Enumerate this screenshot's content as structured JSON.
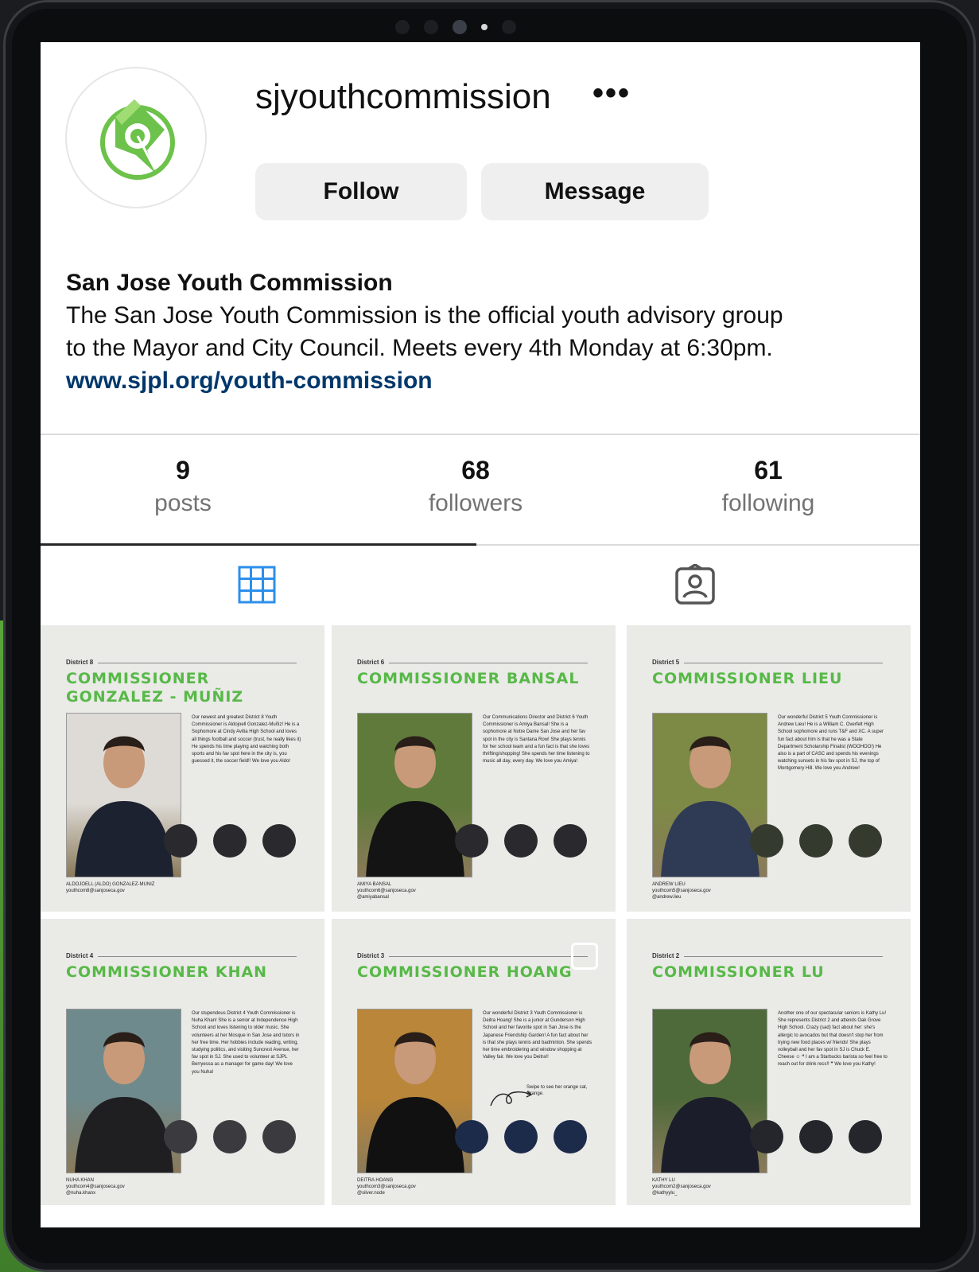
{
  "profile": {
    "username": "sjyouthcommission",
    "more_label": "•••",
    "follow_label": "Follow",
    "message_label": "Message",
    "display_name": "San Jose Youth Commission",
    "bio_line1": "The San Jose Youth Commission is the official youth advisory group",
    "bio_line2": "to the Mayor and City Council. Meets every 4th Monday at 6:30pm.",
    "website": "www.sjpl.org/youth-commission"
  },
  "stats": [
    {
      "value": "9",
      "label": "posts"
    },
    {
      "value": "68",
      "label": "followers"
    },
    {
      "value": "61",
      "label": "following"
    }
  ],
  "tabs": [
    "grid-icon",
    "tagged-icon"
  ],
  "posts": [
    {
      "district": "District 8",
      "title_line1": "COMMISSIONER",
      "title_line2": "GONZALEZ - MUÑIZ",
      "bio": "Our newest and greatest District 8 Youth Commissioner is Aldojoell Gonzalez-Muñiz! He is a Sophomore at Cindy Avitia High School and loves all things football and soccer (trust, he really likes it) He spends his time playing and watching both sports and his fav spot here in the city is, you guessed it, the soccer field!! We love you Aldo!",
      "footer": [
        "ALDOJOELL (ALDO) GONZALEZ-MUNIZ",
        "youthcom8@sanjoseca.gov"
      ],
      "circle_color": "#2a2a2e",
      "bg": "#dedbd6",
      "shirt": "#1d2230"
    },
    {
      "district": "District 6",
      "title_line1": "COMMISSIONER BANSAL",
      "title_line2": "",
      "bio": "Our Communications Director and District 6 Youth Commissioner is Amiya Bansal! She is a sophomore at Notre Dame San Jose and her fav spot in the city is Santana Row! She plays tennis for her school team and a fun fact is that she loves thrifting/shopping! She spends her time listening to music all day, every day. We love you Amiya!",
      "footer": [
        "AMIYA BANSAL",
        "youthcom6@sanjoseca.gov",
        "@amiyabansal"
      ],
      "circle_color": "#2a2a2e",
      "bg": "#5f7a3a",
      "shirt": "#141414"
    },
    {
      "district": "District 5",
      "title_line1": "COMMISSIONER LIEU",
      "title_line2": "",
      "bio": "Our wonderful District 5 Youth Commissioner is Andrew Lieu! He is a William C. Overfelt High School sophomore and runs T&F and XC. A super fun fact about him is that he was a State Department Scholarship Finalist (WOOHOO!) He also is a part of CASC and spends his evenings watching sunsets in his fav spot in SJ, the top of Montgomery Hill. We love you Andrew!",
      "footer": [
        "ANDREW LIEU",
        "youthcom5@sanjoseca.gov",
        "@andrew.lieu"
      ],
      "circle_color": "#343a2e",
      "bg": "#7d8a45",
      "shirt": "#2f3a55"
    },
    {
      "district": "District 4",
      "title_line1": "COMMISSIONER KHAN",
      "title_line2": "",
      "bio": "Our stupendous District 4 Youth Commissioner is Nuha Khan! She is a senior at Independence High School and loves listening to older music. She volunteers at her Mosque in San Jose and tutors in her free time. Her hobbies include reading, writing, studying politics, and visiting Suncrest Avenue, her fav spot in SJ. She used to volunteer at SJPL Berryessa as a manager for game day! We love you Nuha!",
      "footer": [
        "NUHA KHAN",
        "youthcom4@sanjoseca.gov",
        "@nuha.khanx"
      ],
      "circle_color": "#3b3b3f",
      "bg": "#6f8a8c",
      "shirt": "#1f1f22"
    },
    {
      "district": "District 3",
      "title_line1": "COMMISSIONER HOANG",
      "title_line2": "",
      "bio": "Our wonderful District 3 Youth Commissioner is Deitra Hoang! She is a junior at Gunderson High School and her favorite spot in San Jose is the Japanese Friendship Garden! A fun fact about her is that she plays tennis and badminton. She spends her time embroidering and window shopping at Valley fair. We love you Deitra!!",
      "note": "Swipe to see her orange cat, Orange.",
      "footer": [
        "DEITRA HOANG",
        "youthcom3@sanjoseca.gov",
        "@silver.node"
      ],
      "circle_color": "#1d2b4a",
      "bg": "#b9863a",
      "shirt": "#111111"
    },
    {
      "district": "District 2",
      "title_line1": "COMMISSIONER LU",
      "title_line2": "",
      "bio": "Another one of our spectacular seniors is Kathy Lu! She represents District 2 and attends Oak Grove High School. Crazy (sad) fact about her: she's allergic to avocados but that doesn't stop her from trying new food places w/ friends! She plays volleyball and her fav spot in SJ is Chuck E. Cheese ☺ ❝ I am a Starbucks barista so feel free to reach out for drink recs!! ❞ We love you Kathy!",
      "footer": [
        "KATHY LU",
        "youthcom2@sanjoseca.gov",
        "@kathyylu_"
      ],
      "circle_color": "#25262c",
      "bg": "#4f6a3a",
      "shirt": "#1b1e2a"
    }
  ]
}
